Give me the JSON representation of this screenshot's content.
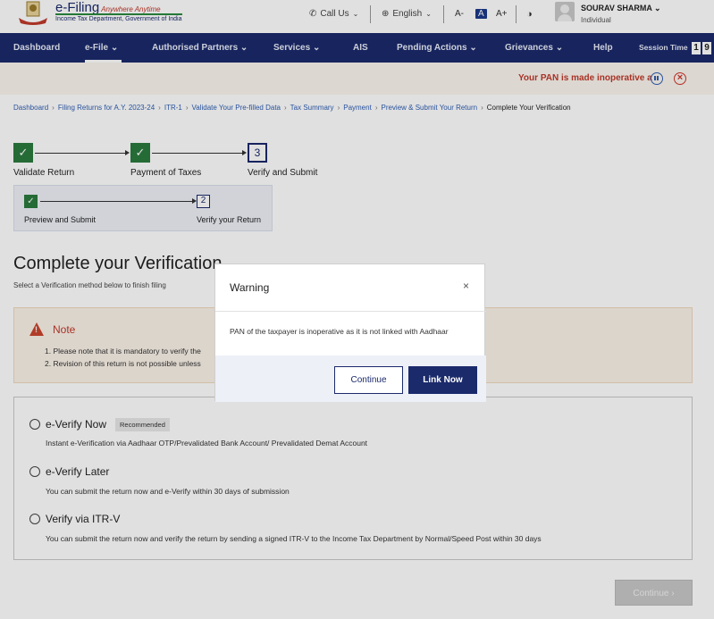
{
  "header": {
    "logo_title": "e-Filing",
    "logo_tagline": "Anywhere Anytime",
    "logo_subtitle": "Income Tax Department, Government of India",
    "call_us": "Call Us",
    "language": "English",
    "font_decrease": "A-",
    "font_normal": "A",
    "font_increase": "A+",
    "user_name": "SOURAV SHARMA",
    "user_role": "Individual"
  },
  "nav": {
    "items": [
      "Dashboard",
      "e-File",
      "Authorised Partners",
      "Services",
      "AIS",
      "Pending Actions",
      "Grievances",
      "Help"
    ],
    "active": "e-File",
    "session_label": "Session Time",
    "session_digits": [
      "1",
      "9"
    ]
  },
  "alert": {
    "text": "Your PAN is made inoperative a"
  },
  "breadcrumb": [
    "Dashboard",
    "Filing Returns for A.Y. 2023-24",
    "ITR-1",
    "Validate Your Pre-filled Data",
    "Tax Summary",
    "Payment",
    "Preview & Submit Your Return",
    "Complete Your Verification"
  ],
  "stepper": {
    "steps": [
      {
        "label": "Validate Return",
        "status": "done"
      },
      {
        "label": "Payment of Taxes",
        "status": "done"
      },
      {
        "label": "Verify and Submit",
        "number": "3",
        "status": "current"
      }
    ],
    "substeps": [
      {
        "label": "Preview and Submit",
        "status": "done"
      },
      {
        "label": "Verify your Return",
        "number": "2",
        "status": "current"
      }
    ]
  },
  "main": {
    "title": "Complete your Verification",
    "subtitle": "Select a Verification method below to finish filing",
    "note_title": "Note",
    "note_lines": [
      "1. Please note that it is mandatory to verify the",
      "2. Revision of this return is not possible unless"
    ],
    "options": [
      {
        "label": "e-Verify Now",
        "badge": "Recommended",
        "desc": "Instant e-Verification via Aadhaar OTP/Prevalidated Bank Account/ Prevalidated Demat Account"
      },
      {
        "label": "e-Verify Later",
        "desc": "You can submit the return now and e-Verify within 30 days of submission"
      },
      {
        "label": "Verify via ITR-V",
        "desc": "You can submit the return now and verify the return by sending a signed ITR-V to the Income Tax Department by Normal/Speed Post within 30 days"
      }
    ],
    "continue_label": "Continue"
  },
  "modal": {
    "title": "Warning",
    "close": "×",
    "body": "PAN of the taxpayer is inoperative as it is not linked with Aadhaar",
    "continue_label": "Continue",
    "link_now_label": "Link Now"
  },
  "colors": {
    "brand_navy": "#1b2a6b",
    "success_green": "#2b7a3e",
    "alert_red": "#c0392b"
  }
}
